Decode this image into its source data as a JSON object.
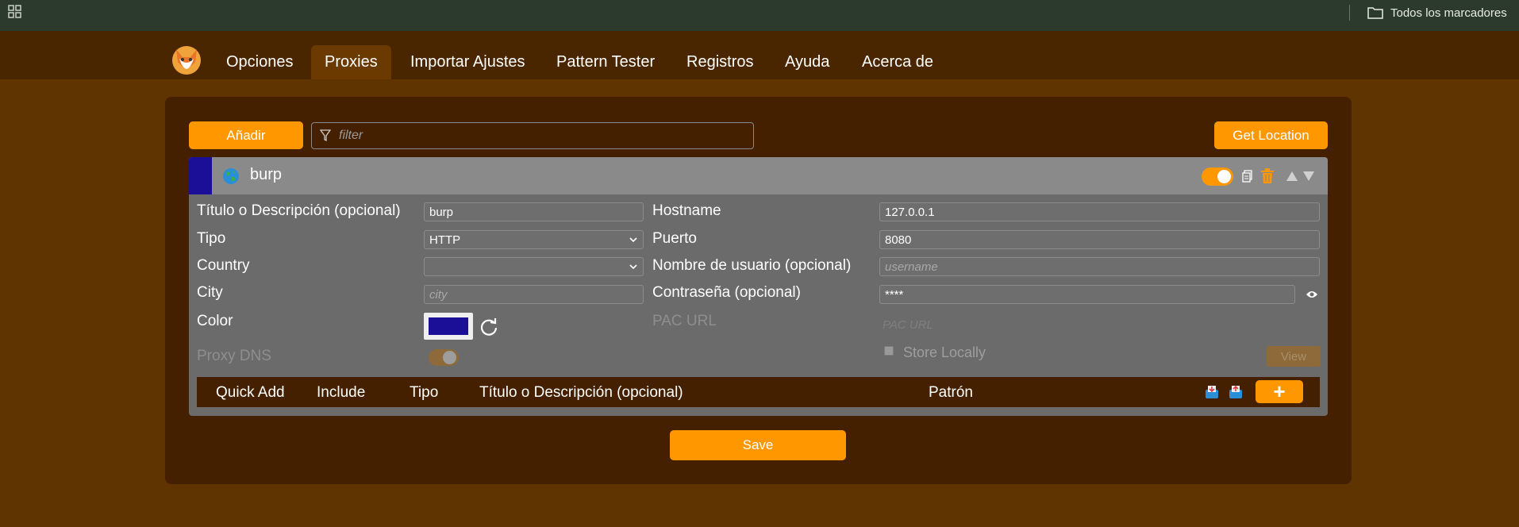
{
  "bookmarks": {
    "all_bookmarks_label": "Todos los marcadores"
  },
  "nav": {
    "tabs": [
      {
        "label": "Opciones",
        "active": false
      },
      {
        "label": "Proxies",
        "active": true
      },
      {
        "label": "Importar Ajustes",
        "active": false
      },
      {
        "label": "Pattern Tester",
        "active": false
      },
      {
        "label": "Registros",
        "active": false
      },
      {
        "label": "Ayuda",
        "active": false
      },
      {
        "label": "Acerca de",
        "active": false
      }
    ]
  },
  "toolbar": {
    "add_label": "Añadir",
    "filter_placeholder": "filter",
    "get_location_label": "Get Location"
  },
  "proxy": {
    "name": "burp",
    "color": "#1a0f96",
    "enabled": true,
    "fields": {
      "title_label": "Título o Descripción (opcional)",
      "title_value": "burp",
      "type_label": "Tipo",
      "type_value": "HTTP",
      "country_label": "Country",
      "country_value": "",
      "city_label": "City",
      "city_placeholder": "city",
      "color_label": "Color",
      "proxy_dns_label": "Proxy DNS",
      "proxy_dns_enabled": true,
      "hostname_label": "Hostname",
      "hostname_value": "127.0.0.1",
      "port_label": "Puerto",
      "port_value": "8080",
      "username_label": "Nombre de usuario (opcional)",
      "username_placeholder": "username",
      "password_label": "Contraseña (opcional)",
      "password_value": "****",
      "pac_url_label": "PAC URL",
      "pac_url_placeholder": "PAC URL",
      "store_locally_label": "Store Locally",
      "store_locally_checked": false,
      "view_label": "View"
    },
    "rules_header": {
      "quick_add": "Quick Add",
      "include": "Include",
      "type": "Tipo",
      "title": "Título o Descripción (opcional)",
      "pattern": "Patrón",
      "add_rule_label": "+"
    }
  },
  "save_label": "Save",
  "colors": {
    "accent": "#ff9700",
    "background": "#5f3400",
    "panel": "#442000",
    "nav": "#4a2600"
  }
}
